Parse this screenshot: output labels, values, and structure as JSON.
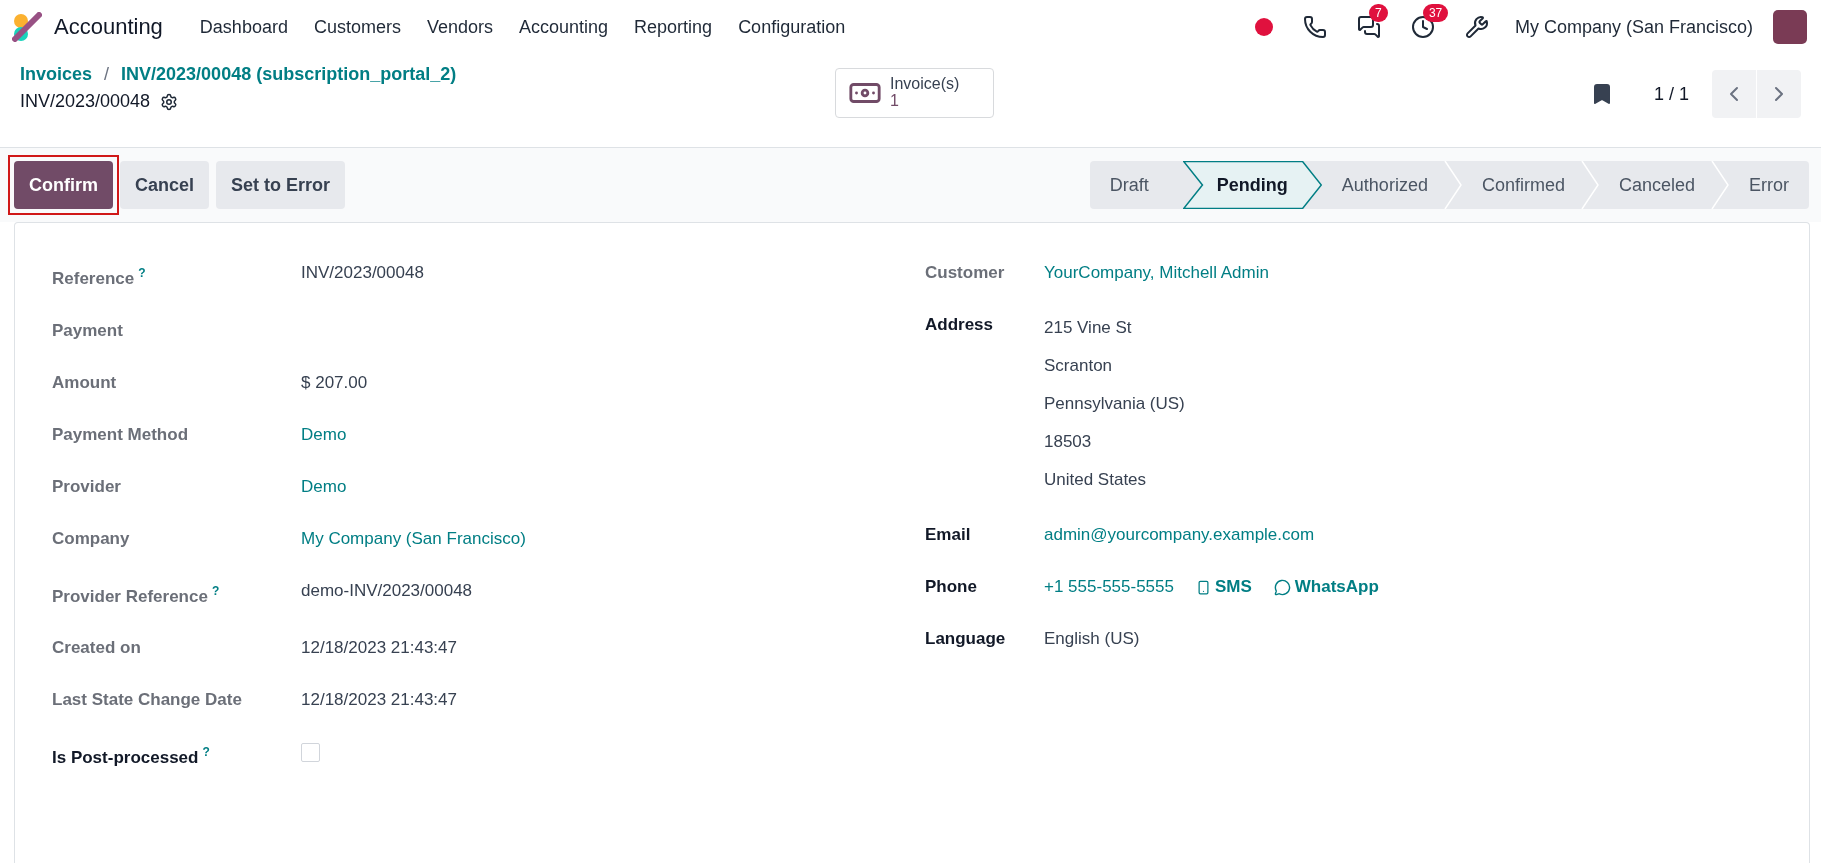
{
  "navbar": {
    "app_name": "Accounting",
    "menu": [
      "Dashboard",
      "Customers",
      "Vendors",
      "Accounting",
      "Reporting",
      "Configuration"
    ],
    "badges": [
      {
        "kind": "chat",
        "count": "7"
      },
      {
        "kind": "activity",
        "count": "37"
      }
    ],
    "company": "My Company (San Francisco)"
  },
  "breadcrumb": {
    "separator": "/",
    "items": [
      "Invoices",
      "INV/2023/00048 (subscription_portal_2)"
    ],
    "title": "INV/2023/00048"
  },
  "smart_button": {
    "label": "Invoice(s)",
    "count": "1"
  },
  "pager": {
    "text": "1 / 1"
  },
  "actions": [
    {
      "label": "Confirm",
      "primary": true,
      "highlighted": true
    },
    {
      "label": "Cancel",
      "primary": false,
      "highlighted": false
    },
    {
      "label": "Set to Error",
      "primary": false,
      "highlighted": false
    }
  ],
  "stages": [
    {
      "label": "Draft",
      "selected": false
    },
    {
      "label": "Pending",
      "selected": true
    },
    {
      "label": "Authorized",
      "selected": false
    },
    {
      "label": "Confirmed",
      "selected": false
    },
    {
      "label": "Canceled",
      "selected": false
    },
    {
      "label": "Error",
      "selected": false
    }
  ],
  "left_fields": [
    {
      "label": "Reference",
      "help": "?",
      "readonly": true,
      "kind": "text",
      "value": "INV/2023/00048"
    },
    {
      "label": "Payment",
      "readonly": true,
      "kind": "text"
    },
    {
      "label": "Amount",
      "readonly": true,
      "kind": "text",
      "value": "$ 207.00"
    },
    {
      "label": "Payment Method",
      "readonly": true,
      "kind": "link",
      "value": "Demo"
    },
    {
      "label": "Provider",
      "readonly": true,
      "kind": "link",
      "value": "Demo"
    },
    {
      "label": "Company",
      "readonly": true,
      "kind": "link",
      "value": "My Company (San Francisco)"
    },
    {
      "label": "Provider Reference",
      "help": "?",
      "readonly": true,
      "kind": "text",
      "value": "demo-INV/2023/00048"
    },
    {
      "label": "Created on",
      "readonly": true,
      "kind": "text",
      "value": "12/18/2023 21:43:47"
    },
    {
      "label": "Last State Change Date",
      "readonly": true,
      "kind": "text",
      "value": "12/18/2023 21:43:47"
    },
    {
      "label": "Is Post-processed",
      "help": "?",
      "readonly": false,
      "kind": "checkbox",
      "checked": false
    }
  ],
  "right_fields": [
    {
      "label": "Customer",
      "readonly": true,
      "kind": "link",
      "value": "YourCompany, Mitchell Admin"
    },
    {
      "label": "Address",
      "readonly": false,
      "kind": "lines",
      "lines": [
        "215 Vine St",
        "Scranton",
        "Pennsylvania (US)",
        "18503",
        "United States"
      ]
    },
    {
      "label": "Email",
      "readonly": false,
      "kind": "link",
      "value": "admin@yourcompany.example.com"
    },
    {
      "label": "Phone",
      "readonly": false,
      "kind": "phone",
      "value": "+1 555-555-5555",
      "links": [
        {
          "kind": "sms",
          "label": "SMS"
        },
        {
          "kind": "whatsapp",
          "label": "WhatsApp"
        }
      ]
    },
    {
      "label": "Language",
      "readonly": false,
      "kind": "text",
      "value": "English (US)"
    }
  ]
}
